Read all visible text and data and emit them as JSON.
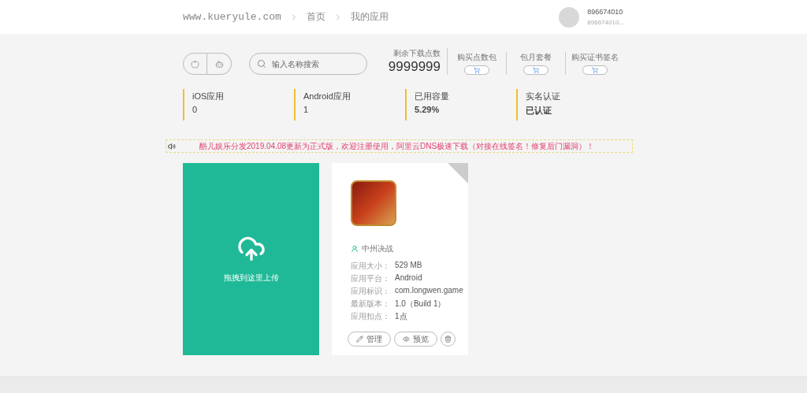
{
  "header": {
    "site": "www.kueryule.com",
    "breadcrumbs": [
      "首页",
      "我的应用"
    ],
    "user": {
      "name": "896674010",
      "subname": "896674010..."
    }
  },
  "toolbar": {
    "search": {
      "placeholder": "输入名称搜索"
    },
    "balance": {
      "label": "剩余下载点数",
      "value": "9999999"
    },
    "purchases": [
      {
        "label": "购买点数包"
      },
      {
        "label": "包月套餐"
      },
      {
        "label": "购买证书签名"
      }
    ]
  },
  "stats": [
    {
      "label": "iOS应用",
      "value": "0",
      "emphasis": false
    },
    {
      "label": "Android应用",
      "value": "1",
      "emphasis": false
    },
    {
      "label": "已用容量",
      "value": "5.29%",
      "emphasis": true
    },
    {
      "label": "实名认证",
      "value": "已认证",
      "emphasis": true
    }
  ],
  "notice": {
    "text": "酷儿娱乐分发2019.04.08更新为正式版，欢迎注册使用，阿里云DNS极速下载（对接在线签名！修复后门漏洞）！"
  },
  "upload": {
    "label": "拖拽到这里上传"
  },
  "apps": [
    {
      "name": "中州决战",
      "fields": [
        {
          "label": "应用大小：",
          "value": "529 MB"
        },
        {
          "label": "应用平台：",
          "value": "Android"
        },
        {
          "label": "应用标识：",
          "value": "com.longwen.game"
        },
        {
          "label": "最新版本：",
          "value": "1.0（Build 1）"
        },
        {
          "label": "应用扣点：",
          "value": "1点"
        }
      ],
      "actions": [
        {
          "kind": "edit",
          "label": "管理"
        },
        {
          "kind": "preview",
          "label": "预览"
        },
        {
          "kind": "delete"
        }
      ]
    }
  ]
}
